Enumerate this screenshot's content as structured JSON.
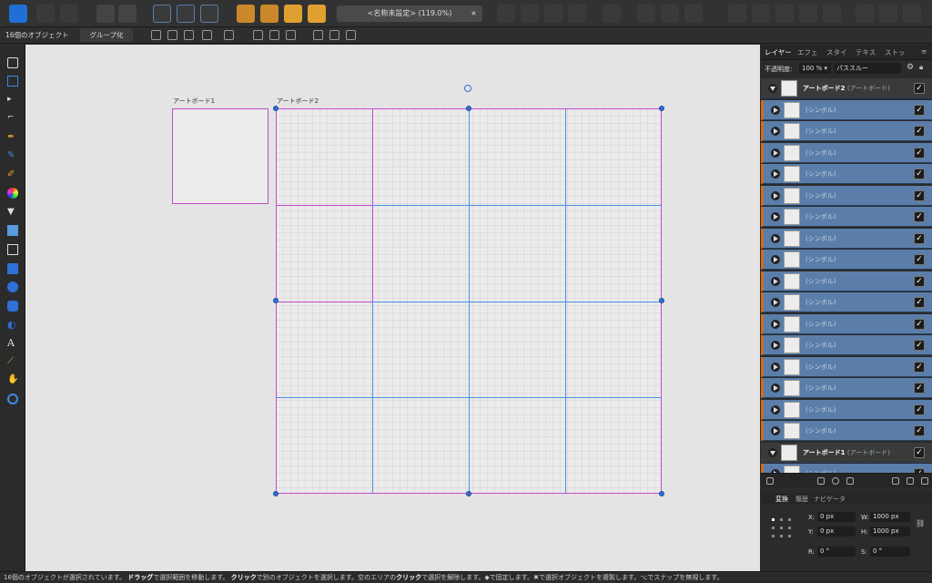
{
  "toolbar": {
    "document_title": "<名称未設定> (119.0%)",
    "star": "★",
    "accent_color": "#1f6fd6"
  },
  "context_bar": {
    "selection_count": "16個のオブジェクト",
    "group_button": "グループ化"
  },
  "tools": [
    "move-tool",
    "artboard-tool",
    "node-tool",
    "corner-tool",
    "pen-tool",
    "pencil-tool",
    "vector-brush-tool",
    "fill-tool",
    "transparency-tool",
    "place-image-tool",
    "crop-tool",
    "rectangle-tool",
    "ellipse-tool",
    "rounded-rect-tool",
    "crescent-tool",
    "text-tool",
    "color-picker-tool",
    "view-tool",
    "zoom-tool"
  ],
  "canvas": {
    "artboard1_label": "アートボード1",
    "artboard2_label": "アートボード2",
    "artboard_border_color": "#c44bc9",
    "grid_line_color": "#4a90e2",
    "grid_columns": 4,
    "grid_rows": 4
  },
  "panel": {
    "tabs": [
      "レイヤー",
      "エフェ",
      "スタイ",
      "テキス",
      "ストッ"
    ],
    "opacity_label": "不透明度:",
    "opacity_value": "100 %",
    "blend_mode": "パススルー",
    "artboard2_name": "アートボード2",
    "artboard2_sub": "(アートボード)",
    "symbol_name": "(シンボル)",
    "symbol_count": 16,
    "artboard1_name": "アートボード1",
    "artboard1_sub": "(アートボード)",
    "check": "✓"
  },
  "transform": {
    "tabs": [
      "変換",
      "履歴",
      "ナビゲータ"
    ],
    "x_label": "X:",
    "x_value": "0 px",
    "y_label": "Y:",
    "y_value": "0 px",
    "w_label": "W:",
    "w_value": "1000 px",
    "h_label": "H:",
    "h_value": "1000 px",
    "r_label": "R:",
    "r_value": "0 °",
    "s_label": "S:",
    "s_value": "0 °"
  },
  "status": {
    "p1": "16個のオブジェクトが選択されています。",
    "b1": "ドラッグ",
    "p2": "で選択範囲を移動します。",
    "b2": "クリック",
    "p3": "で別のオブジェクトを選択します。空のエリアの",
    "b3": "クリック",
    "p4": "で選択を解除します。◆で固定します。✖で選択オブジェクトを複製します。⌥でスナップを無視します。"
  }
}
